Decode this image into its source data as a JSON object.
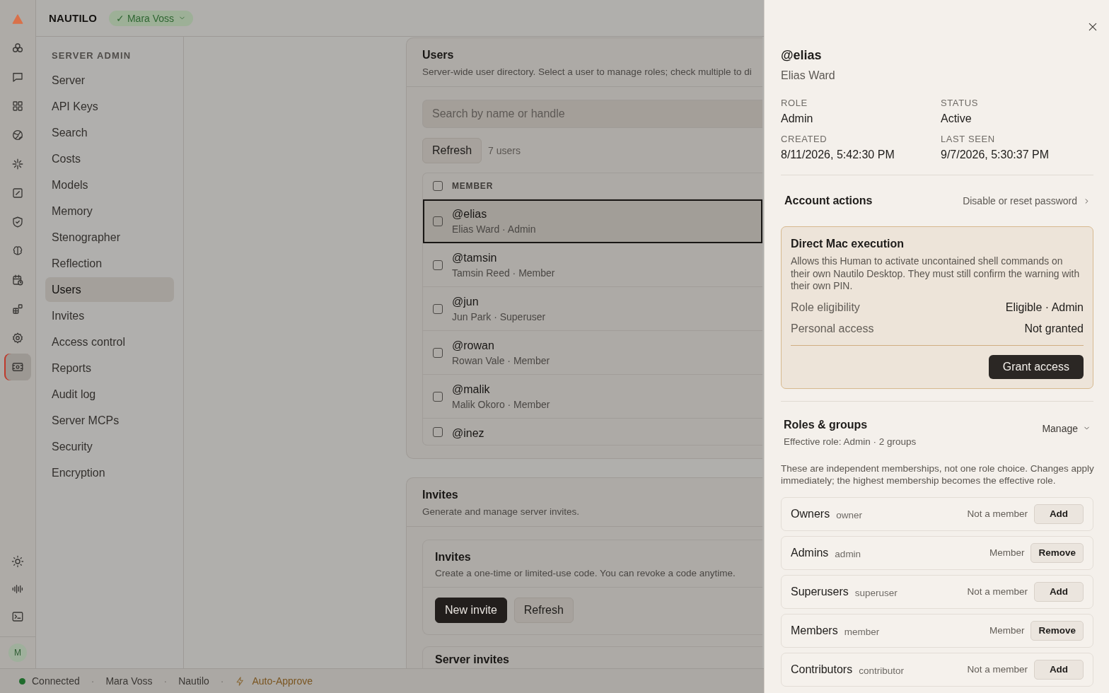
{
  "app": {
    "name": "NAUTILO",
    "badge": "✓ Mara Voss"
  },
  "rail": {
    "top": [
      {
        "kind": "agents",
        "selected": false
      },
      {
        "kind": "chat",
        "selected": false
      },
      {
        "kind": "grid",
        "selected": false
      },
      {
        "kind": "globe",
        "selected": false
      },
      {
        "kind": "sparkle",
        "selected": false
      },
      {
        "kind": "edit",
        "selected": false
      },
      {
        "kind": "shield",
        "selected": false
      },
      {
        "kind": "brain",
        "selected": false
      },
      {
        "kind": "calendar",
        "selected": false
      },
      {
        "kind": "blocks",
        "selected": false
      },
      {
        "kind": "gear",
        "selected": false
      },
      {
        "kind": "admin",
        "selected": true
      }
    ],
    "bottom": [
      {
        "kind": "sun"
      },
      {
        "kind": "wave"
      },
      {
        "kind": "terminal"
      }
    ],
    "avatar": "M"
  },
  "sidebar": {
    "heading": "SERVER ADMIN",
    "items": [
      {
        "label": "Server",
        "selected": false
      },
      {
        "label": "API Keys",
        "selected": false
      },
      {
        "label": "Search",
        "selected": false
      },
      {
        "label": "Costs",
        "selected": false
      },
      {
        "label": "Models",
        "selected": false
      },
      {
        "label": "Memory",
        "selected": false
      },
      {
        "label": "Stenographer",
        "selected": false
      },
      {
        "label": "Reflection",
        "selected": false
      },
      {
        "label": "Users",
        "selected": true
      },
      {
        "label": "Invites",
        "selected": false
      },
      {
        "label": "Access control",
        "selected": false
      },
      {
        "label": "Reports",
        "selected": false
      },
      {
        "label": "Audit log",
        "selected": false
      },
      {
        "label": "Server MCPs",
        "selected": false
      },
      {
        "label": "Security",
        "selected": false
      },
      {
        "label": "Encryption",
        "selected": false
      }
    ]
  },
  "users": {
    "title": "Users",
    "description": "Server-wide user directory. Select a user to manage roles; check multiple to di",
    "search": {
      "placeholder": "Search by name or handle"
    },
    "refresh": "Refresh",
    "count": "7 users",
    "header": {
      "label": "MEMBER",
      "checked": false
    },
    "rows": [
      {
        "handle": "@elias",
        "subtitle": "Elias Ward · Admin",
        "checked": false,
        "selected": true
      },
      {
        "handle": "@tamsin",
        "subtitle": "Tamsin Reed · Member",
        "checked": false,
        "selected": false
      },
      {
        "handle": "@jun",
        "subtitle": "Jun Park · Superuser",
        "checked": false,
        "selected": false
      },
      {
        "handle": "@rowan",
        "subtitle": "Rowan Vale · Member",
        "checked": false,
        "selected": false
      },
      {
        "handle": "@malik",
        "subtitle": "Malik Okoro · Member",
        "checked": false,
        "selected": false
      },
      {
        "handle": "@inez",
        "checked": false,
        "selected": false
      }
    ]
  },
  "invites": {
    "title": "Invites",
    "description": "Generate and manage server invites.",
    "inner": {
      "title": "Invites",
      "description": "Create a one-time or limited-use code. You can revoke a code anytime.",
      "buttons": [
        {
          "label": "New invite",
          "kind": "primary"
        },
        {
          "label": "Refresh",
          "kind": "secondary"
        }
      ]
    },
    "next_title": "Server invites"
  },
  "status_bar": [
    {
      "kind": "status",
      "label": "Connected",
      "color": "#1f6b2c"
    },
    {
      "kind": "sep",
      "label": "·"
    },
    {
      "kind": "text",
      "label": "Mara Voss"
    },
    {
      "kind": "sep",
      "label": "·"
    },
    {
      "kind": "text",
      "label": "Nautilo"
    },
    {
      "kind": "sep",
      "label": "·"
    },
    {
      "kind": "mode",
      "label": "Auto-Approve"
    }
  ],
  "drawer": {
    "handle": "@elias",
    "name": "Elias Ward",
    "fields": [
      {
        "label": "ROLE",
        "value": "Admin"
      },
      {
        "label": "STATUS",
        "value": "Active"
      },
      {
        "label": "CREATED",
        "value": "8/11/2026, 5:42:30 PM"
      },
      {
        "label": "LAST SEEN",
        "value": "9/7/2026, 5:30:37 PM"
      }
    ],
    "account": {
      "title": "Account actions",
      "link": "Disable or reset password"
    },
    "exec": {
      "title": "Direct Mac execution",
      "description": "Allows this Human to activate uncontained shell commands on their own Nautilo Desktop. They must still confirm the warning with their own PIN.",
      "rows": [
        {
          "label": "Role eligibility",
          "value": "Eligible · Admin"
        },
        {
          "label": "Personal access",
          "value": "Not granted"
        }
      ],
      "button": "Grant access"
    },
    "roles": {
      "title": "Roles & groups",
      "summary": "Effective role: Admin · 2 groups",
      "manage": "Manage",
      "note": "These are independent memberships, not one role choice. Changes apply immediately; the highest membership becomes the effective role.",
      "groups": [
        {
          "name": "Owners",
          "slug": "owner",
          "status": "Not a member",
          "action": "Add"
        },
        {
          "name": "Admins",
          "slug": "admin",
          "status": "Member",
          "action": "Remove"
        },
        {
          "name": "Superusers",
          "slug": "superuser",
          "status": "Not a member",
          "action": "Add"
        },
        {
          "name": "Members",
          "slug": "member",
          "status": "Member",
          "action": "Remove"
        },
        {
          "name": "Contributors",
          "slug": "contributor",
          "status": "Not a member",
          "action": "Add"
        }
      ]
    }
  }
}
